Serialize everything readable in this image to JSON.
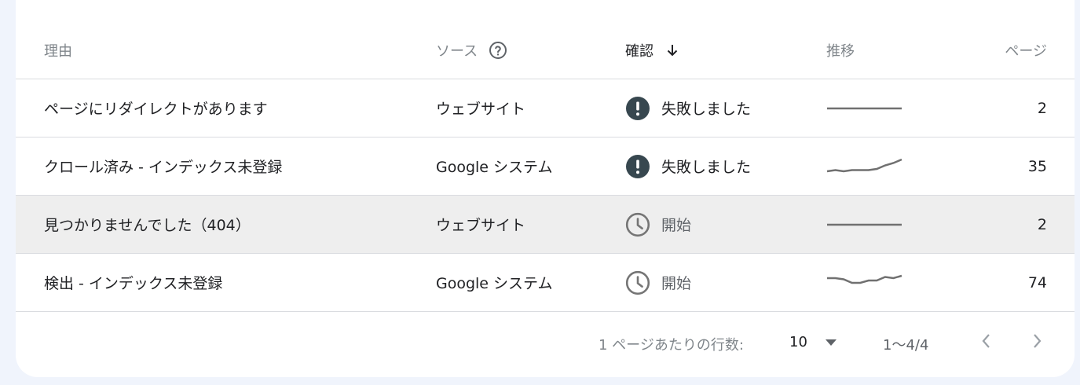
{
  "table": {
    "headers": {
      "reason": "理由",
      "source": "ソース",
      "status": "確認",
      "trend": "推移",
      "pages": "ページ"
    },
    "rows": [
      {
        "reason": "ページにリダイレクトがあります",
        "source": "ウェブサイト",
        "status": "失敗しました",
        "status_icon": "exclamation-circle-icon",
        "trend": [
          0.5,
          0.5,
          0.5,
          0.5,
          0.5,
          0.5,
          0.5,
          0.5,
          0.5,
          0.5
        ],
        "pages": "2"
      },
      {
        "reason": "クロール済み - インデックス未登録",
        "source": "Google システム",
        "status": "失敗しました",
        "status_icon": "exclamation-circle-icon",
        "trend": [
          0.3,
          0.35,
          0.3,
          0.35,
          0.35,
          0.35,
          0.4,
          0.55,
          0.65,
          0.8
        ],
        "pages": "35"
      },
      {
        "reason": "見つかりませんでした（404）",
        "source": "ウェブサイト",
        "status": "開始",
        "status_icon": "clock-icon",
        "trend": [
          0.5,
          0.5,
          0.5,
          0.5,
          0.5,
          0.5,
          0.5,
          0.5,
          0.5,
          0.5
        ],
        "pages": "2"
      },
      {
        "reason": "検出 - インデックス未登録",
        "source": "Google システム",
        "status": "開始",
        "status_icon": "clock-icon",
        "trend": [
          0.7,
          0.7,
          0.65,
          0.5,
          0.5,
          0.6,
          0.6,
          0.75,
          0.7,
          0.8
        ],
        "pages": "74"
      }
    ],
    "highlighted_row": 2
  },
  "pagination": {
    "rows_per_page_label": "1 ページあたりの行数:",
    "rows_per_page_value": "10",
    "range": "1～4/4"
  },
  "colors": {
    "fail_icon": "#37474f",
    "clock_icon": "#757575",
    "sparkline": "#707070",
    "divider": "#dadce0",
    "highlight": "#eeeeee"
  }
}
